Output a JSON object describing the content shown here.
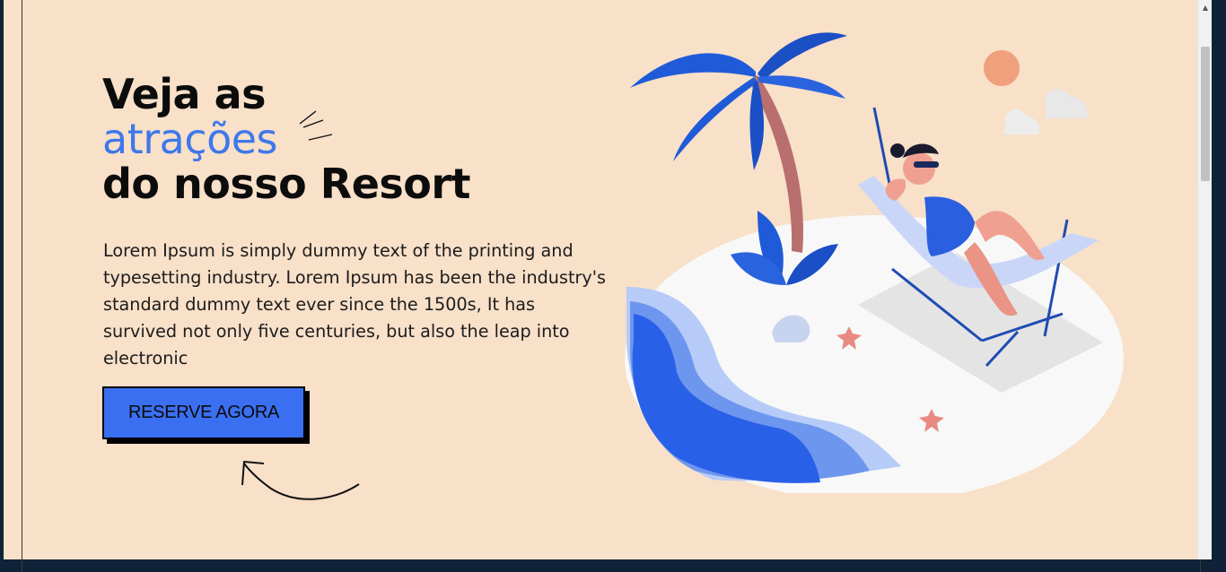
{
  "hero": {
    "title_line1": "Veja as",
    "title_accent": "atrações",
    "title_line3": "do nosso Resort",
    "description": "Lorem Ipsum is simply dummy text of the printing and typesetting industry. Lorem Ipsum has been the industry's standard dummy text ever since the 1500s, It has survived not only five centuries, but also the leap into electronic",
    "cta_label": "RESERVE AGORA"
  },
  "colors": {
    "background": "#f8e0c9",
    "accent": "#3e78ea",
    "button": "#3b6ff2",
    "text": "#0c0c0c"
  },
  "icons": {
    "sparkle": "sparkle-lines-icon",
    "arrow": "curved-arrow-icon",
    "illustration": "beach-resort-illustration"
  }
}
